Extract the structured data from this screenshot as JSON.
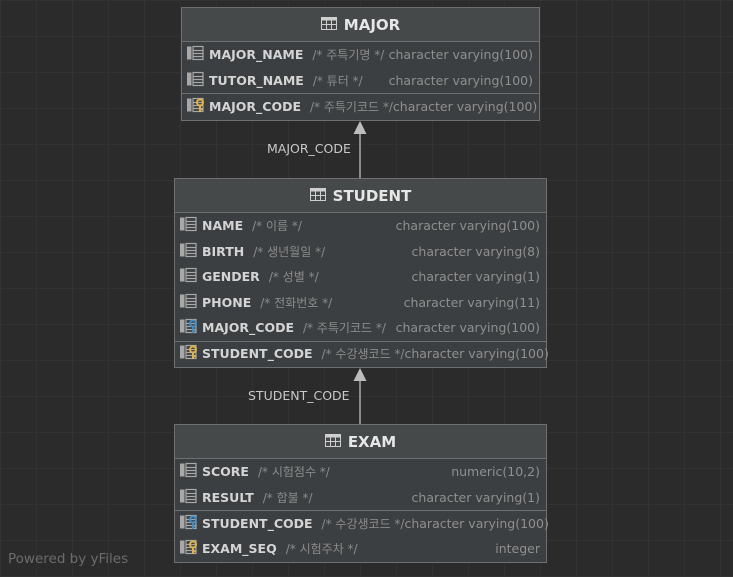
{
  "tables": [
    {
      "id": "major",
      "title": "MAJOR",
      "rows": [
        {
          "name": "MAJOR_NAME",
          "comment": "/* 주특기명 */",
          "type": "character varying(100)",
          "icon": "column-icon"
        },
        {
          "name": "TUTOR_NAME",
          "comment": "/* 튜터 */",
          "type": "character varying(100)",
          "icon": "column-icon"
        },
        {
          "name": "MAJOR_CODE",
          "comment": "/* 주특기코드 */",
          "type": "character varying(100)",
          "icon": "primary-key-icon"
        }
      ]
    },
    {
      "id": "student",
      "title": "STUDENT",
      "rows": [
        {
          "name": "NAME",
          "comment": "/* 이름 */",
          "type": "character varying(100)",
          "icon": "column-icon"
        },
        {
          "name": "BIRTH",
          "comment": "/* 생년월일 */",
          "type": "character varying(8)",
          "icon": "column-icon"
        },
        {
          "name": "GENDER",
          "comment": "/* 성별 */",
          "type": "character varying(1)",
          "icon": "column-icon"
        },
        {
          "name": "PHONE",
          "comment": "/* 전화번호 */",
          "type": "character varying(11)",
          "icon": "column-icon"
        },
        {
          "name": "MAJOR_CODE",
          "comment": "/* 주특기코드 */",
          "type": "character varying(100)",
          "icon": "foreign-key-icon"
        },
        {
          "name": "STUDENT_CODE",
          "comment": "/* 수강생코드 */",
          "type": "character varying(100)",
          "icon": "primary-key-icon"
        }
      ]
    },
    {
      "id": "exam",
      "title": "EXAM",
      "rows": [
        {
          "name": "SCORE",
          "comment": "/* 시험점수 */",
          "type": "numeric(10,2)",
          "icon": "column-icon"
        },
        {
          "name": "RESULT",
          "comment": "/* 합불 */",
          "type": "character varying(1)",
          "icon": "column-icon"
        },
        {
          "name": "STUDENT_CODE",
          "comment": "/* 수강생코드 */",
          "type": "character varying(100)",
          "icon": "foreign-primary-key-icon"
        },
        {
          "name": "EXAM_SEQ",
          "comment": "/* 시험주차 */",
          "type": "integer",
          "icon": "primary-key-icon"
        }
      ]
    }
  ],
  "edges": [
    {
      "from": "student",
      "to": "major",
      "label": "MAJOR_CODE"
    },
    {
      "from": "exam",
      "to": "student",
      "label": "STUDENT_CODE"
    }
  ],
  "watermark": "Powered by yFiles",
  "colors": {
    "background": "#2b2b2b",
    "table_body": "#3c3f41",
    "table_header": "#45494a",
    "border": "#6d6f71",
    "key_gold": "#e3b341",
    "key_blue": "#3d8ec9"
  }
}
